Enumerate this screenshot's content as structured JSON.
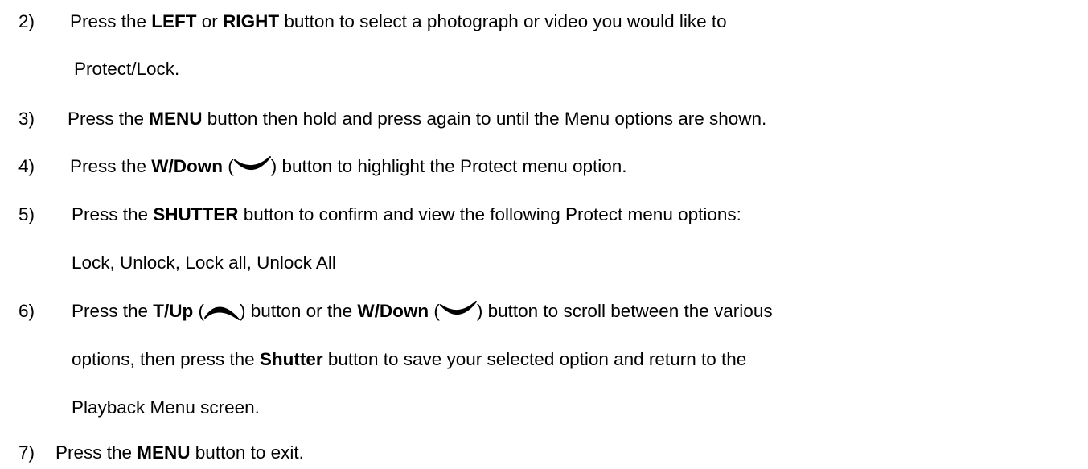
{
  "steps": [
    {
      "number": "2)",
      "lines": [
        [
          "Press the ",
          "LEFT",
          " or ",
          "RIGHT",
          " button to select a photograph or video you would like to"
        ],
        [
          "Protect/Lock."
        ]
      ]
    },
    {
      "number": "3)",
      "lines": [
        [
          "Press the ",
          "MENU",
          " button then hold and press again to until the Menu options are shown."
        ]
      ]
    },
    {
      "number": "4)",
      "lines": [
        [
          "Press the ",
          "W/Down",
          " (",
          ") button to highlight the Protect menu option."
        ]
      ]
    },
    {
      "number": "5)",
      "lines": [
        [
          "Press the ",
          "SHUTTER",
          " button to confirm and view the following Protect menu options:"
        ],
        [
          "Lock, Unlock, Lock all, Unlock All"
        ]
      ]
    },
    {
      "number": "6)",
      "lines": [
        [
          "Press the ",
          "T/Up",
          " (",
          ") button or the ",
          "W/Down",
          " (",
          ") button to scroll between the various"
        ],
        [
          "options, then press the ",
          "Shutter",
          " button to save your selected option and return to the"
        ],
        [
          "Playback Menu screen."
        ]
      ]
    },
    {
      "number": "7)",
      "lines": [
        [
          "Press the ",
          "MENU",
          " button to exit."
        ]
      ]
    }
  ],
  "icons": {
    "down": "chevron-down-icon",
    "up": "chevron-up-icon"
  },
  "colors": {
    "text": "#000000",
    "background": "#ffffff"
  }
}
